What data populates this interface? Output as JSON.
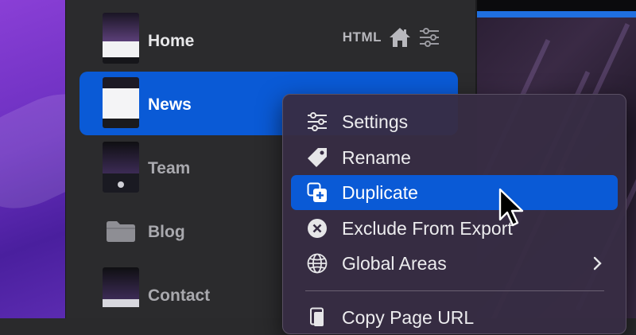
{
  "sidebar": {
    "pages": [
      {
        "label": "Home",
        "tag": "HTML",
        "selected": false
      },
      {
        "label": "News",
        "selected": true
      },
      {
        "label": "Team",
        "selected": false
      },
      {
        "label": "Blog",
        "kind": "folder",
        "selected": false
      },
      {
        "label": "Contact",
        "selected": false
      }
    ]
  },
  "context_menu": {
    "items": [
      {
        "label": "Settings",
        "icon": "sliders-icon"
      },
      {
        "label": "Rename",
        "icon": "tag-icon"
      },
      {
        "label": "Duplicate",
        "icon": "duplicate-icon",
        "highlighted": true
      },
      {
        "label": "Exclude From Export",
        "icon": "x-circle-icon"
      },
      {
        "label": "Global Areas",
        "icon": "globe-icon",
        "submenu": true
      },
      {
        "label": "Copy Page URL",
        "icon": "copy-link-icon"
      }
    ]
  },
  "colors": {
    "selection": "#0a5ad6",
    "sidebar_bg": "#2b2b2d",
    "menu_bg": "#372d44",
    "accent_bar": "#1f6fe0"
  }
}
